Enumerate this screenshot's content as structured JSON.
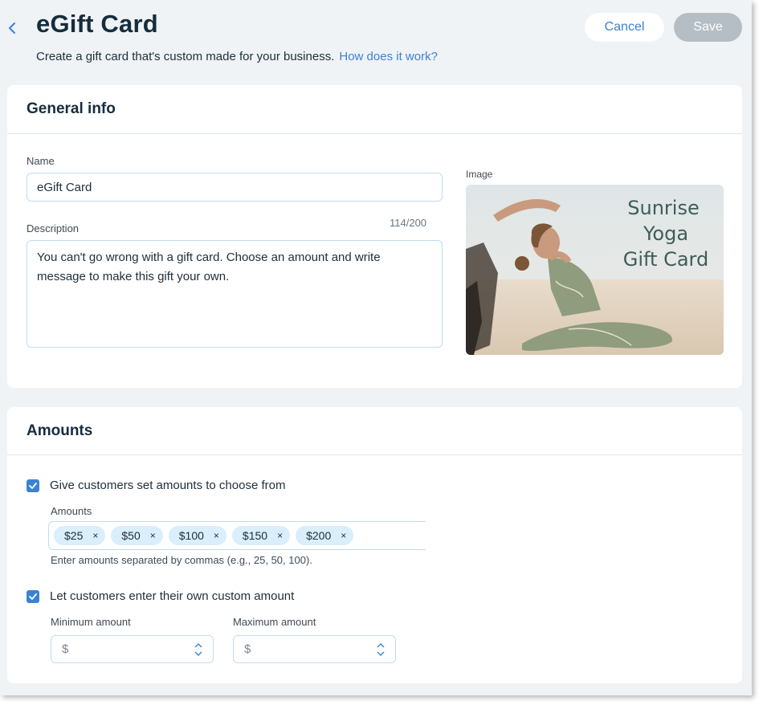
{
  "header": {
    "title": "eGift Card",
    "subtitle": "Create a gift card that's custom made for your business.",
    "help_link": "How does it work?",
    "cancel_label": "Cancel",
    "save_label": "Save"
  },
  "general": {
    "title": "General info",
    "name_label": "Name",
    "name_value": "eGift Card",
    "description_label": "Description",
    "description_counter": "114/200",
    "description_value": "You can't go wrong with a gift card. Choose an amount and write message to make this gift your own.",
    "image_label": "Image",
    "image_text": [
      "Sunrise",
      "Yoga",
      "Gift Card"
    ]
  },
  "amounts": {
    "title": "Amounts",
    "set_amounts_checkbox": {
      "label": "Give customers set amounts to choose from",
      "checked": true
    },
    "amounts_label": "Amounts",
    "tags": [
      "$25",
      "$50",
      "$100",
      "$150",
      "$200"
    ],
    "remove_glyph": "×",
    "hint": "Enter amounts separated by commas (e.g., 25, 50, 100).",
    "custom_amount_checkbox": {
      "label": "Let customers enter their own custom amount",
      "checked": true
    },
    "min_label": "Minimum amount",
    "max_label": "Maximum amount",
    "currency_symbol": "$"
  },
  "colors": {
    "accent": "#3b82d4",
    "background": "#eff3f6",
    "save_disabled": "#b5bec5",
    "tag_bg": "#daeefb"
  },
  "icons": {
    "back": "chevron-left-icon",
    "check": "checkmark-icon",
    "remove": "close-icon",
    "stepper": "chevron-up-down-icon"
  }
}
